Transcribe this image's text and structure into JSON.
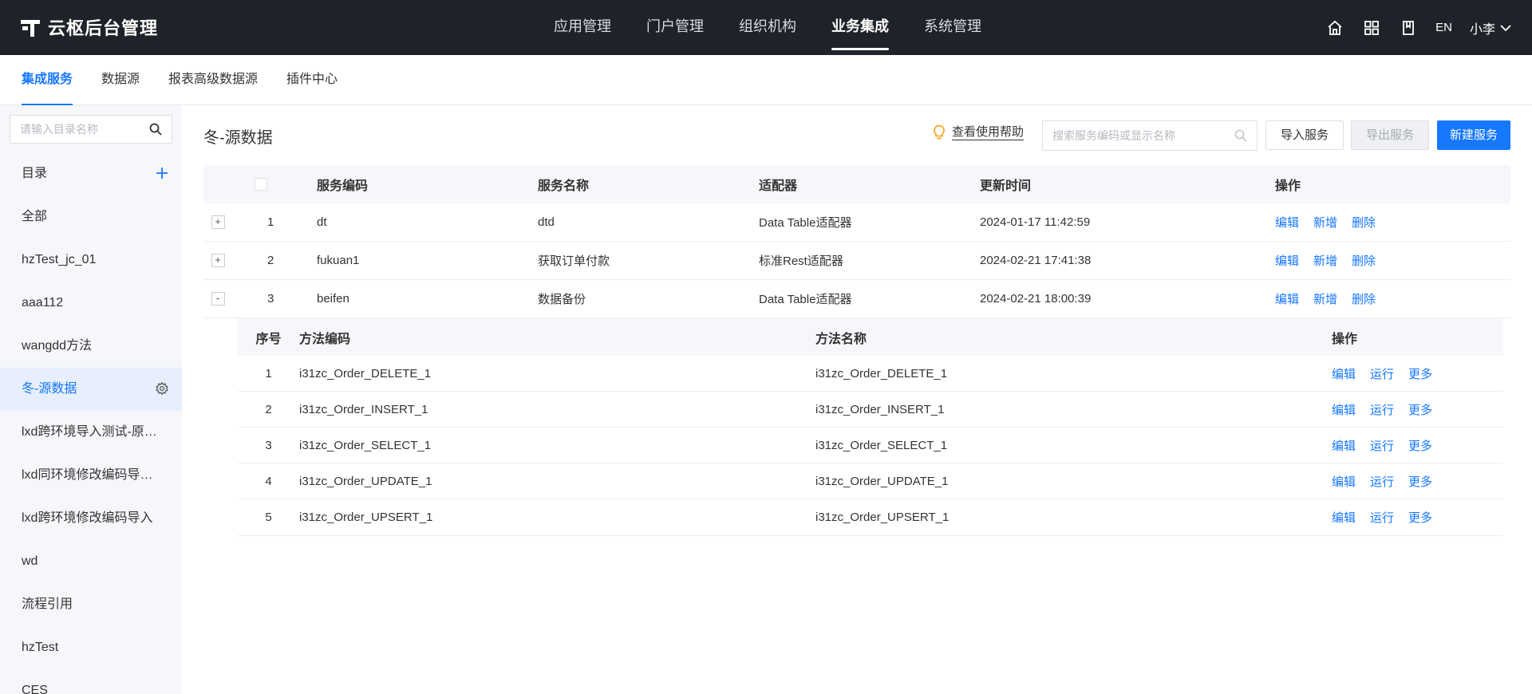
{
  "app": {
    "title": "云枢后台管理"
  },
  "topnav": [
    {
      "label": "应用管理",
      "active": false
    },
    {
      "label": "门户管理",
      "active": false
    },
    {
      "label": "组织机构",
      "active": false
    },
    {
      "label": "业务集成",
      "active": true
    },
    {
      "label": "系统管理",
      "active": false
    }
  ],
  "topright": {
    "icons": [
      "home-icon",
      "grid-icon",
      "book-icon"
    ],
    "lang": "EN",
    "user": "小李"
  },
  "subnav": [
    {
      "label": "集成服务",
      "active": true
    },
    {
      "label": "数据源",
      "active": false
    },
    {
      "label": "报表高级数据源",
      "active": false
    },
    {
      "label": "插件中心",
      "active": false
    }
  ],
  "sidebar": {
    "search_placeholder": "请输入目录名称",
    "catalog_label": "目录",
    "items": [
      {
        "label": "全部",
        "active": false
      },
      {
        "label": "hzTest_jc_01",
        "active": false
      },
      {
        "label": "aaa112",
        "active": false
      },
      {
        "label": "wangdd方法",
        "active": false
      },
      {
        "label": "冬-源数据",
        "active": true
      },
      {
        "label": "lxd跨环境导入测试-原数据",
        "active": false
      },
      {
        "label": "lxd同环境修改编码导入测试",
        "active": false
      },
      {
        "label": "lxd跨环境修改编码导入",
        "active": false
      },
      {
        "label": "wd",
        "active": false
      },
      {
        "label": "流程引用",
        "active": false
      },
      {
        "label": "hzTest",
        "active": false
      },
      {
        "label": "CES",
        "active": false
      }
    ]
  },
  "main": {
    "title": "冬-源数据",
    "help_label": "查看使用帮助",
    "search_placeholder": "搜索服务编码或显示名称",
    "buttons": {
      "import": "导入服务",
      "export": "导出服务",
      "new": "新建服务"
    },
    "table": {
      "headers": {
        "code": "服务编码",
        "name": "服务名称",
        "adapter": "适配器",
        "time": "更新时间",
        "ops": "操作"
      },
      "rows": [
        {
          "expand": "+",
          "index": "1",
          "code": "dt",
          "name": "dtd",
          "adapter": "Data Table适配器",
          "time": "2024-01-17 11:42:59",
          "ops": [
            "编辑",
            "新增",
            "删除"
          ]
        },
        {
          "expand": "+",
          "index": "2",
          "code": "fukuan1",
          "name": "获取订单付款",
          "adapter": "标准Rest适配器",
          "time": "2024-02-21 17:41:38",
          "ops": [
            "编辑",
            "新增",
            "删除"
          ]
        },
        {
          "expand": "-",
          "index": "3",
          "code": "beifen",
          "name": "数据备份",
          "adapter": "Data Table适配器",
          "time": "2024-02-21 18:00:39",
          "ops": [
            "编辑",
            "新增",
            "删除"
          ]
        }
      ]
    },
    "subtable": {
      "headers": {
        "index": "序号",
        "code": "方法编码",
        "name": "方法名称",
        "ops": "操作"
      },
      "rows": [
        {
          "index": "1",
          "code": "i31zc_Order_DELETE_1",
          "name": "i31zc_Order_DELETE_1",
          "ops": [
            "编辑",
            "运行",
            "更多"
          ]
        },
        {
          "index": "2",
          "code": "i31zc_Order_INSERT_1",
          "name": "i31zc_Order_INSERT_1",
          "ops": [
            "编辑",
            "运行",
            "更多"
          ]
        },
        {
          "index": "3",
          "code": "i31zc_Order_SELECT_1",
          "name": "i31zc_Order_SELECT_1",
          "ops": [
            "编辑",
            "运行",
            "更多"
          ]
        },
        {
          "index": "4",
          "code": "i31zc_Order_UPDATE_1",
          "name": "i31zc_Order_UPDATE_1",
          "ops": [
            "编辑",
            "运行",
            "更多"
          ]
        },
        {
          "index": "5",
          "code": "i31zc_Order_UPSERT_1",
          "name": "i31zc_Order_UPSERT_1",
          "ops": [
            "编辑",
            "运行",
            "更多"
          ]
        }
      ]
    }
  },
  "colors": {
    "accent": "#1677ff",
    "topbar": "#1f2329",
    "sidebar": "#f5f7fa",
    "active_bg": "#e6effb"
  }
}
